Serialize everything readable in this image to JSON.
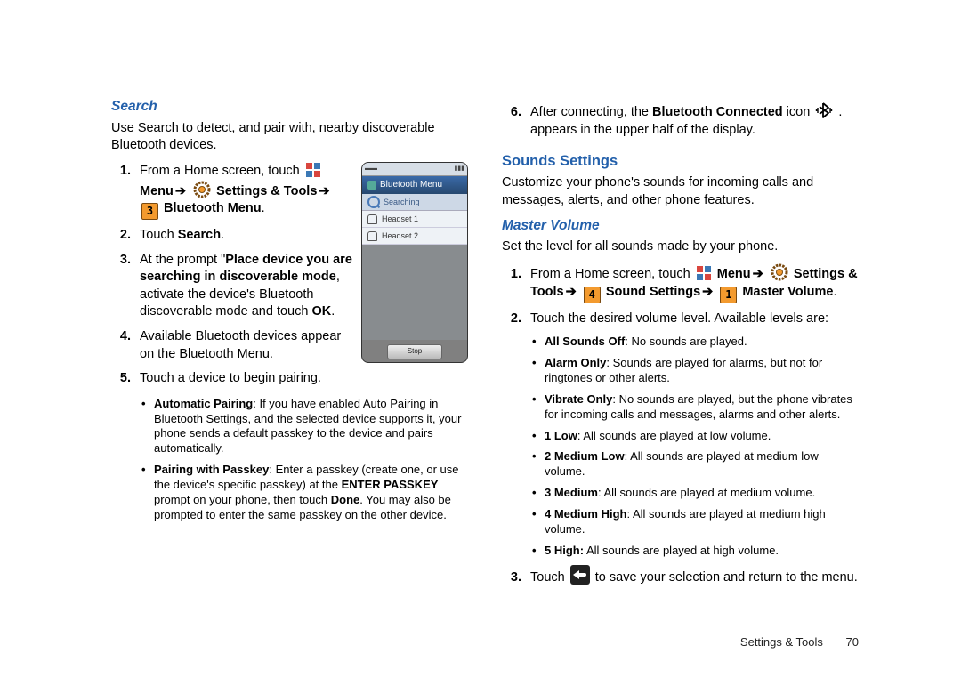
{
  "col1": {
    "h_search": "Search",
    "intro": "Use Search to detect, and pair with, nearby discoverable Bluetooth devices.",
    "s1a": "From a Home screen, touch ",
    "menu": "Menu",
    "settings_tools": "Settings & Tools",
    "btmenu": "Bluetooth Menu",
    "s2a": "Touch ",
    "s2b": "Search",
    "s3a": "At the prompt \"",
    "s3b": "Place device you are searching in discoverable mode",
    "s3c": ", activate the device's Bluetooth discoverable mode and touch ",
    "s3d": "OK",
    "s4": "Available Bluetooth devices appear on the Bluetooth Menu.",
    "s5": "Touch a device to begin pairing.",
    "ap_label": "Automatic Pairing",
    "ap_text": ": If you have enabled Auto Pairing in Bluetooth Settings, and the selected device supports it, your phone sends a default passkey to the device and pairs automatically.",
    "pk_label": "Pairing with Passkey",
    "pk_t1": ": Enter a passkey (create one, or use the device's specific passkey) at the ",
    "pk_ep": "ENTER PASSKEY",
    "pk_t2": " prompt on your phone, then touch ",
    "pk_done": "Done",
    "pk_t3": ". You may also be prompted to enter the same passkey on the other device."
  },
  "phone": {
    "title": "Bluetooth Menu",
    "searching": "Searching",
    "h1": "Headset 1",
    "h2": "Headset 2",
    "stop": "Stop"
  },
  "col2": {
    "s6a": "After connecting, the ",
    "s6b": "Bluetooth Connected",
    "s6c": " icon ",
    "s6d": ". appears in the upper half of the display.",
    "h_sounds": "Sounds Settings",
    "sounds_intro": "Customize your phone's sounds for incoming calls and messages, alerts, and other phone features.",
    "h_master": "Master Volume",
    "master_intro": "Set the level for all sounds made by your phone.",
    "m1a": "From a Home screen, touch ",
    "menu": "Menu",
    "settings_tools": "Settings & Tools",
    "sound_settings": "Sound Settings",
    "master_volume": "Master Volume",
    "m2": "Touch the desired volume level. Available levels are:",
    "lv": [
      {
        "b": "All Sounds Off",
        "t": ": No sounds are played."
      },
      {
        "b": "Alarm Only",
        "t": ": Sounds are played for alarms, but not for ringtones or other alerts."
      },
      {
        "b": "Vibrate Only",
        "t": ": No sounds are played, but the phone vibrates for incoming calls and messages, alarms and other alerts."
      },
      {
        "b": "1 Low",
        "t": ": All sounds are played at low volume."
      },
      {
        "b": "2 Medium Low",
        "t": ": All sounds are played at medium low volume."
      },
      {
        "b": "3 Medium",
        "t": ": All sounds are played at medium volume."
      },
      {
        "b": "4 Medium High",
        "t": ": All sounds are played at medium high volume."
      },
      {
        "b": "5 High:",
        "t": " All sounds are played at high volume."
      }
    ],
    "m3a": "Touch ",
    "m3b": " to save your selection and return to the menu."
  },
  "footer": {
    "section": "Settings & Tools",
    "page": "70"
  },
  "keys": {
    "k3": "3",
    "k4": "4",
    "k1": "1"
  }
}
